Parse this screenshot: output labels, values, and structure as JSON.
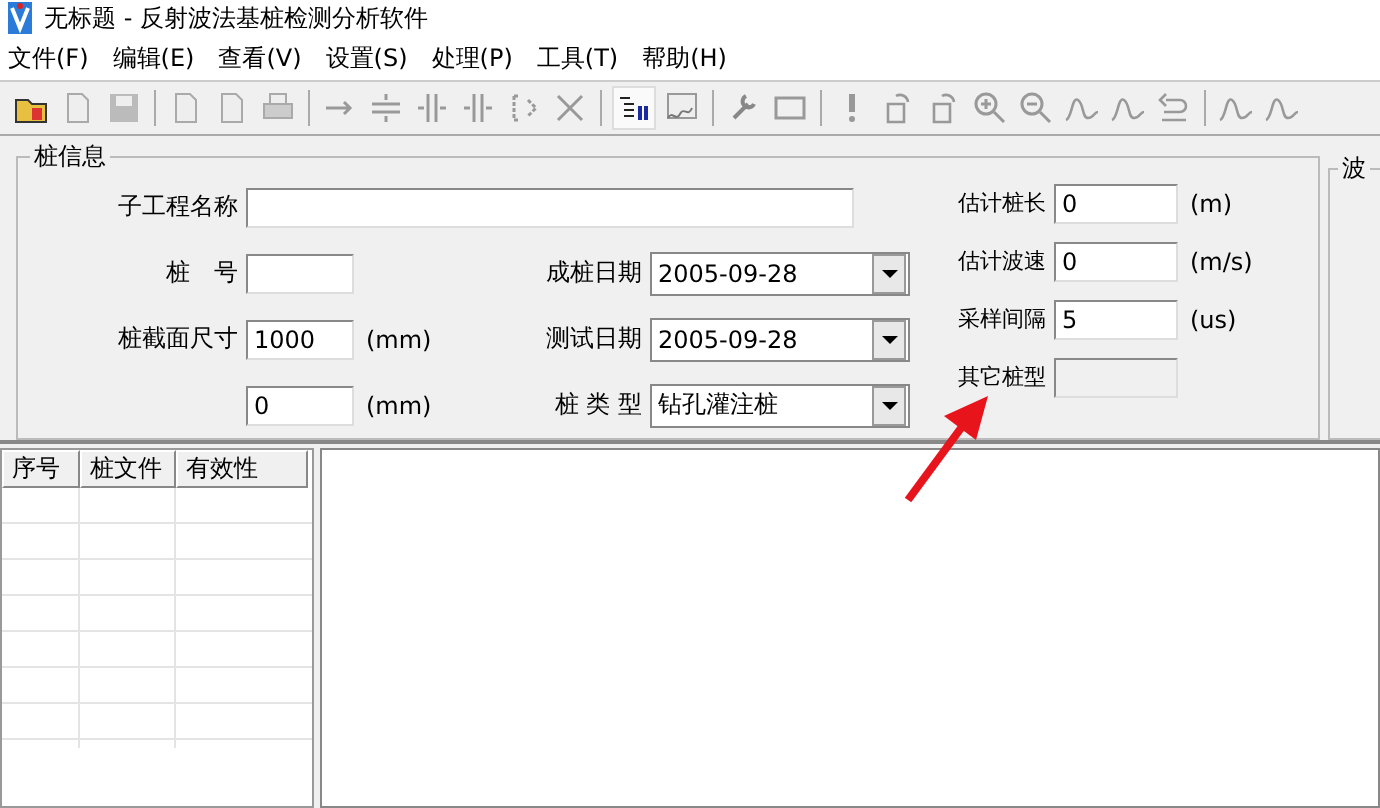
{
  "window": {
    "title": "无标题 - 反射波法基桩检测分析软件"
  },
  "menu": [
    "文件(F)",
    "编辑(E)",
    "查看(V)",
    "设置(S)",
    "处理(P)",
    "工具(T)",
    "帮助(H)"
  ],
  "pile_info": {
    "title": "桩信息",
    "col1": [
      {
        "kind": "wide_text",
        "label": "子工程名称"
      },
      {
        "kind": "text",
        "label": "桩　号"
      },
      {
        "kind": "text",
        "label": "桩截面尺寸",
        "value": "1000",
        "unit": "(mm)"
      },
      {
        "kind": "text",
        "value": "0",
        "unit": "(mm)"
      }
    ],
    "col2": [
      {
        "kind": "combo",
        "label": "成桩日期",
        "value": "2005-09-28"
      },
      {
        "kind": "combo",
        "label": "测试日期",
        "value": "2005-09-28"
      },
      {
        "kind": "combo",
        "label": "桩 类 型",
        "value": "钻孔灌注桩"
      }
    ],
    "col3": [
      {
        "kind": "text",
        "label": "估计桩长",
        "value": "0",
        "unit": "(m)",
        "disabled": false
      },
      {
        "kind": "text",
        "label": "估计波速",
        "value": "0",
        "unit": "(m/s)",
        "disabled": false
      },
      {
        "kind": "text",
        "label": "采样间隔",
        "value": "5",
        "unit": "(us)",
        "disabled": false
      },
      {
        "kind": "text",
        "label": "其它桩型",
        "disabled": true
      }
    ]
  },
  "waveform_group": {
    "title": "波"
  },
  "file_table": {
    "columns": [
      "序号",
      "桩文件",
      "有效性"
    ]
  }
}
